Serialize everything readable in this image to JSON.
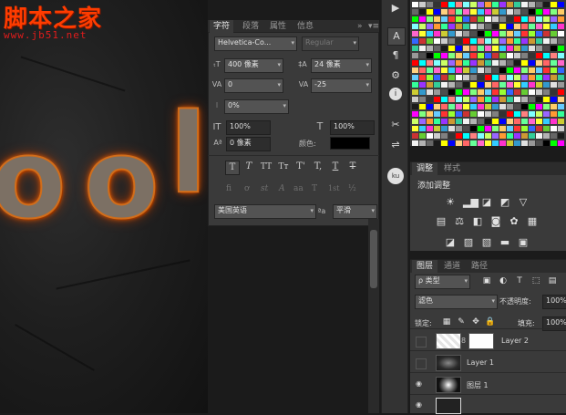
{
  "watermark": {
    "logo": "脚本之家",
    "url": "www.jb51.net"
  },
  "canvas_text": [
    "o",
    "o",
    "l"
  ],
  "character_panel": {
    "tabs": [
      "字符",
      "段落",
      "属性",
      "信息"
    ],
    "font_family": "Helvetica-Co...",
    "font_style": "Regular",
    "font_size": "400 像素",
    "leading": "24 像素",
    "kerning": "0",
    "tracking": "-25",
    "tsume": "0%",
    "vertical_scale": "100%",
    "horizontal_scale": "100%",
    "baseline_shift": "0 像素",
    "color_label": "颜色:",
    "color_value": "#000000",
    "style_buttons": [
      "T",
      "T",
      "TT",
      "Tт",
      "T'",
      "T,",
      "T",
      "T"
    ],
    "opentype_buttons": [
      "fi",
      "ơ",
      "st",
      "A",
      "aa",
      "T",
      "1st",
      "½"
    ],
    "language": "美国英语",
    "aa_label": "ªa",
    "antialias": "平滑"
  },
  "tools": [
    "▶",
    "A",
    "¶",
    "⚙",
    "i",
    "✂",
    "⇌",
    "ku"
  ],
  "swatch_colors": [
    "#ffffff",
    "#f2f2f2",
    "#e0e0e0",
    "#cccccc",
    "#b3b3b3",
    "#999999",
    "#808080",
    "#666666",
    "#4d4d4d",
    "#333333",
    "#1a1a1a",
    "#000000",
    "#ff0000",
    "#ffff00",
    "#00ff00",
    "#00ffff",
    "#0000ff",
    "#ff00ff",
    "#ff8080",
    "#ffd080",
    "#80ff80",
    "#80ffff",
    "#ff6666",
    "#ffcc66",
    "#ccff66",
    "#66ff99",
    "#66ccff",
    "#9966ff",
    "#ff66cc",
    "#ff3333",
    "#ff9933",
    "#ffff33",
    "#99ff33",
    "#33ff99",
    "#33ccff",
    "#3366ff",
    "#9933ff",
    "#ff33cc",
    "#cc3333",
    "#cc9933",
    "#cccc33",
    "#66cc33",
    "#33cc99",
    "#3399cc"
  ],
  "adjustments": {
    "tabs": [
      "调整",
      "样式"
    ],
    "title": "添加调整"
  },
  "layers": {
    "tabs": [
      "图层",
      "通道",
      "路径"
    ],
    "filter_type": "ρ 类型",
    "blend_mode": "滤色",
    "opacity_label": "不透明度:",
    "opacity_value": "100%",
    "lock_label": "锁定:",
    "fill_label": "填充:",
    "fill_value": "100%",
    "rows": [
      {
        "name": "Layer 2"
      },
      {
        "name": "Layer 1"
      },
      {
        "name": "图层 1"
      }
    ]
  }
}
